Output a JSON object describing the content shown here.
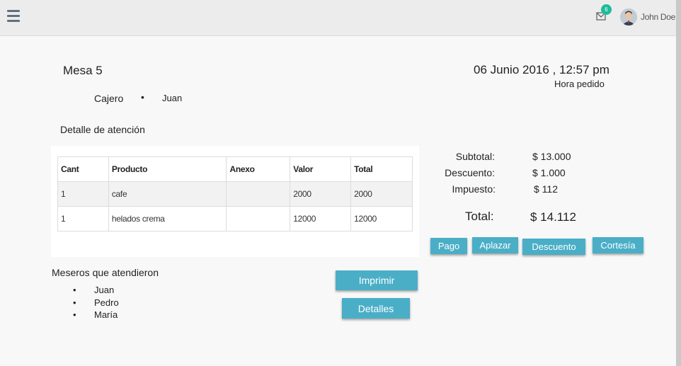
{
  "header": {
    "notification_count": "6",
    "user_name": "John Doe"
  },
  "order": {
    "table_name": "Mesa 5",
    "date": "06 Junio 2016 , 12:57 pm",
    "date_label": "Hora pedido",
    "cashier_label": "Cajero",
    "cashier_name": "Juan",
    "detail_title": "Detalle de atención"
  },
  "items_table": {
    "columns": [
      "Cant",
      "Producto",
      "Anexo",
      "Valor",
      "Total"
    ],
    "rows": [
      [
        "1",
        "cafe",
        "",
        "2000",
        "2000"
      ],
      [
        "1",
        "helados crema",
        "",
        "12000",
        "12000"
      ]
    ]
  },
  "summary": {
    "subtotal_label": "Subtotal:",
    "subtotal_value": "$ 13.000",
    "discount_label": "Descuento:",
    "discount_value": "$ 1.000",
    "tax_label": "Impuesto:",
    "tax_value": "$ 112",
    "total_label": "Total:",
    "total_value": "$ 14.112"
  },
  "actions": {
    "pay": "Pago",
    "postpone": "Aplazar",
    "discount": "Descuento",
    "courtesy": "Cortesía",
    "print": "Imprimir",
    "details": "Detalles"
  },
  "waiters": {
    "title": "Meseros que atendieron",
    "names": [
      "Juan",
      "Pedro",
      "María"
    ]
  },
  "colors": {
    "button": "#4aaec7",
    "badge": "#1bbc9b"
  }
}
